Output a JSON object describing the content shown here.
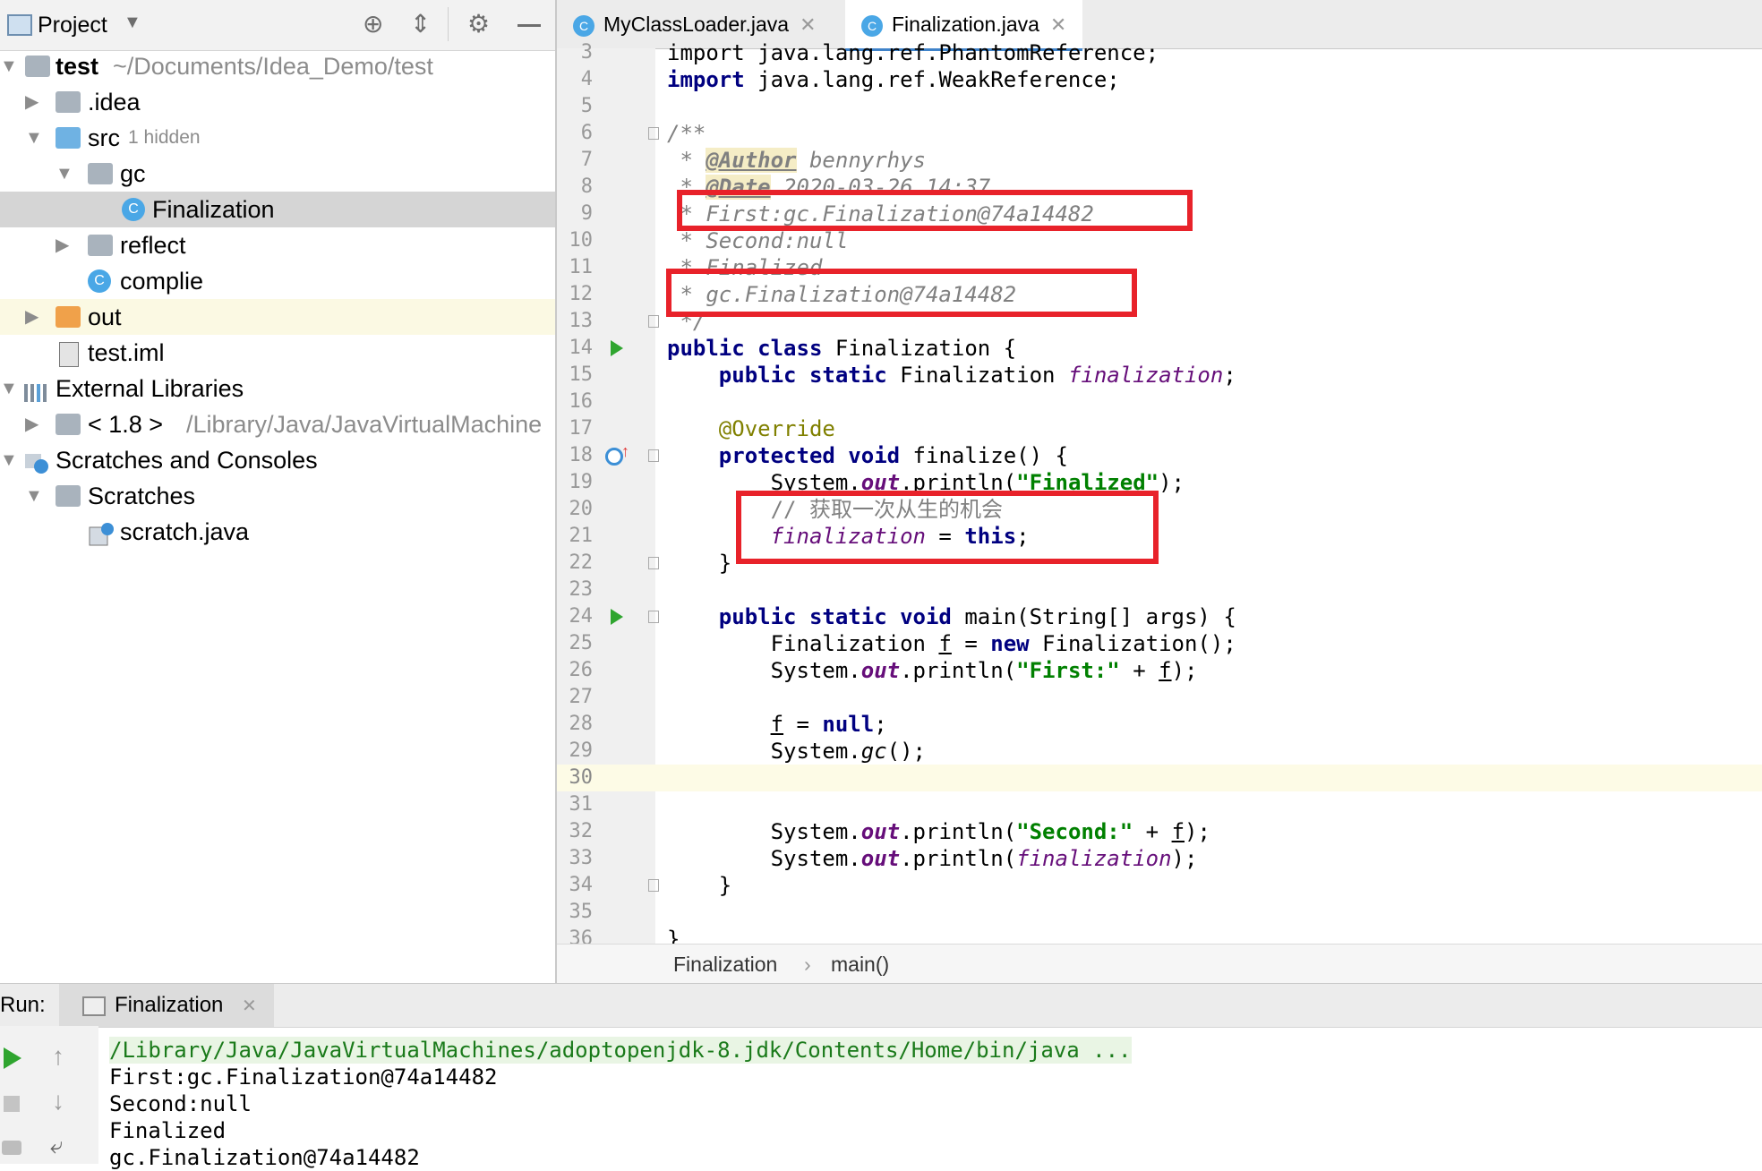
{
  "project": {
    "title": "Project",
    "tree": [
      {
        "label": "test",
        "extra": "~/Documents/Idea_Demo/test"
      },
      {
        "label": ".idea"
      },
      {
        "label": "src",
        "extra": "1 hidden"
      },
      {
        "label": "gc"
      },
      {
        "label": "Finalization"
      },
      {
        "label": "reflect"
      },
      {
        "label": "complie"
      },
      {
        "label": "out"
      },
      {
        "label": "test.iml"
      },
      {
        "label": "External Libraries"
      },
      {
        "label": "< 1.8 >",
        "extra": "/Library/Java/JavaVirtualMachine"
      },
      {
        "label": "Scratches and Consoles"
      },
      {
        "label": "Scratches"
      },
      {
        "label": "scratch.java"
      }
    ]
  },
  "tabs": [
    {
      "label": "MyClassLoader.java"
    },
    {
      "label": "Finalization.java"
    }
  ],
  "code": {
    "line_numbers": [
      "3",
      "4",
      "5",
      "6",
      "7",
      "8",
      "9",
      "10",
      "11",
      "12",
      "13",
      "14",
      "15",
      "16",
      "17",
      "18",
      "19",
      "20",
      "21",
      "22",
      "23",
      "24",
      "25",
      "26",
      "27",
      "28",
      "29",
      "30",
      "31",
      "32",
      "33",
      "34",
      "35",
      "36"
    ],
    "l3": "import java.lang.ref.PhantomReference;",
    "l4_kw": "import",
    "l4_rest": " java.lang.ref.WeakReference;",
    "l6": "/**",
    "l7_star": " * ",
    "l7_tag": "@Author",
    "l7_val": " bennyrhys",
    "l8_star": " * ",
    "l8_tag": "@Date",
    "l8_val": " 2020-03-26 14:37",
    "l9": " * First:gc.Finalization@74a14482",
    "l10": " * Second:null",
    "l11": " * Finalized",
    "l12": " * gc.Finalization@74a14482",
    "l13": " */",
    "l14_kw": "public class",
    "l14_rest": " Finalization {",
    "l15_kw": "    public static",
    "l15_mid": " Finalization ",
    "l15_fld": "finalization",
    "l15_end": ";",
    "l17": "    @Override",
    "l18_kw": "    protected void",
    "l18_rest": " finalize() {",
    "l19_a": "        System.",
    "l19_out": "out",
    "l19_b": ".println(",
    "l19_str": "\"Finalized\"",
    "l19_c": ");",
    "l20": "        // 获取一次从生的机会",
    "l21_pre": "        ",
    "l21_fld": "finalization",
    "l21_mid": " = ",
    "l21_kw": "this",
    "l21_end": ";",
    "l22": "    }",
    "l24_kw": "    public static void",
    "l24_rest": " main(String[] args) {",
    "l25_a": "        Finalization ",
    "l25_f": "f",
    "l25_b": " = ",
    "l25_kw": "new",
    "l25_c": " Finalization();",
    "l26_a": "        System.",
    "l26_out": "out",
    "l26_b": ".println(",
    "l26_str": "\"First:\"",
    "l26_c": " + ",
    "l26_f": "f",
    "l26_d": ");",
    "l28_a": "        ",
    "l28_f": "f",
    "l28_b": " = ",
    "l28_kw": "null",
    "l28_c": ";",
    "l29_a": "        System.",
    "l29_gc": "gc",
    "l29_b": "();",
    "l32_a": "        System.",
    "l32_out": "out",
    "l32_b": ".println(",
    "l32_str": "\"Second:\"",
    "l32_c": " + ",
    "l32_f": "f",
    "l32_d": ");",
    "l33_a": "        System.",
    "l33_out": "out",
    "l33_b": ".println(",
    "l33_fld": "finalization",
    "l33_c": ");",
    "l34": "    }",
    "l36": "}"
  },
  "breadcrumb": {
    "class": "Finalization",
    "sep": "›",
    "method": "main()"
  },
  "run": {
    "label": "Run:",
    "tab": "Finalization",
    "output": [
      "/Library/Java/JavaVirtualMachines/adoptopenjdk-8.jdk/Contents/Home/bin/java ...",
      "First:gc.Finalization@74a14482",
      "Second:null",
      "Finalized",
      "gc.Finalization@74a14482"
    ]
  },
  "colors": {
    "accent": "#4083c9",
    "highlight_box": "#e8222a",
    "run_green": "#2fa52f"
  }
}
